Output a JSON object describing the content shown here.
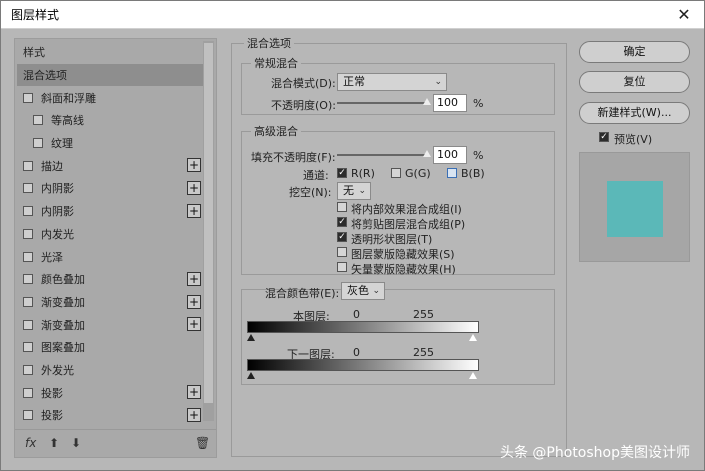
{
  "window": {
    "title": "图层样式",
    "close_glyph": "✕"
  },
  "left": {
    "header": "样式",
    "items": [
      {
        "label": "混合选项",
        "checkbox": false,
        "plus": false,
        "selected": true,
        "indent": false
      },
      {
        "label": "斜面和浮雕",
        "checkbox": true,
        "plus": false,
        "selected": false,
        "indent": false
      },
      {
        "label": "等高线",
        "checkbox": true,
        "plus": false,
        "selected": false,
        "indent": true
      },
      {
        "label": "纹理",
        "checkbox": true,
        "plus": false,
        "selected": false,
        "indent": true
      },
      {
        "label": "描边",
        "checkbox": true,
        "plus": true,
        "selected": false,
        "indent": false
      },
      {
        "label": "内阴影",
        "checkbox": true,
        "plus": true,
        "selected": false,
        "indent": false
      },
      {
        "label": "内阴影",
        "checkbox": true,
        "plus": true,
        "selected": false,
        "indent": false
      },
      {
        "label": "内发光",
        "checkbox": true,
        "plus": false,
        "selected": false,
        "indent": false
      },
      {
        "label": "光泽",
        "checkbox": true,
        "plus": false,
        "selected": false,
        "indent": false
      },
      {
        "label": "颜色叠加",
        "checkbox": true,
        "plus": true,
        "selected": false,
        "indent": false
      },
      {
        "label": "渐变叠加",
        "checkbox": true,
        "plus": true,
        "selected": false,
        "indent": false
      },
      {
        "label": "渐变叠加",
        "checkbox": true,
        "plus": true,
        "selected": false,
        "indent": false
      },
      {
        "label": "图案叠加",
        "checkbox": true,
        "plus": false,
        "selected": false,
        "indent": false
      },
      {
        "label": "外发光",
        "checkbox": true,
        "plus": false,
        "selected": false,
        "indent": false
      },
      {
        "label": "投影",
        "checkbox": true,
        "plus": true,
        "selected": false,
        "indent": false
      },
      {
        "label": "投影",
        "checkbox": true,
        "plus": true,
        "selected": false,
        "indent": false
      }
    ],
    "footer": {
      "fx": "fx",
      "up": "⬆",
      "down": "⬇",
      "trash": "🗑"
    }
  },
  "blend": {
    "section_title": "混合选项",
    "general": {
      "title": "常规混合",
      "mode_label": "混合模式(D):",
      "mode_value": "正常",
      "opacity_label": "不透明度(O):",
      "opacity_value": "100",
      "opacity_level": 1.0,
      "percent": "%"
    },
    "advanced": {
      "title": "高级混合",
      "fill_label": "填充不透明度(F):",
      "fill_value": "100",
      "fill_level": 1.0,
      "percent": "%",
      "channels_label": "通道:",
      "channel_r": "R(R)",
      "channel_g": "G(G)",
      "channel_b": "B(B)",
      "knockout_label": "挖空(N):",
      "knockout_value": "无",
      "options": [
        {
          "label": "将内部效果混合成组(I)",
          "checked": false
        },
        {
          "label": "将剪贴图层混合成组(P)",
          "checked": true
        },
        {
          "label": "透明形状图层(T)",
          "checked": true
        },
        {
          "label": "图层蒙版隐藏效果(S)",
          "checked": false
        },
        {
          "label": "矢量蒙版隐藏效果(H)",
          "checked": false
        }
      ]
    },
    "band": {
      "label": "混合颜色带(E):",
      "value": "灰色",
      "this_layer": "本图层:",
      "this_min": "0",
      "this_max": "255",
      "under_layer": "下一图层:",
      "under_min": "0",
      "under_max": "255"
    }
  },
  "buttons": {
    "ok": "确定",
    "reset": "复位",
    "new_style": "新建样式(W)...",
    "preview_label": "预览(V)"
  },
  "colors": {
    "preview_swatch": "#5bb8b8"
  },
  "watermark": "头条 @Photoshop美图设计师"
}
